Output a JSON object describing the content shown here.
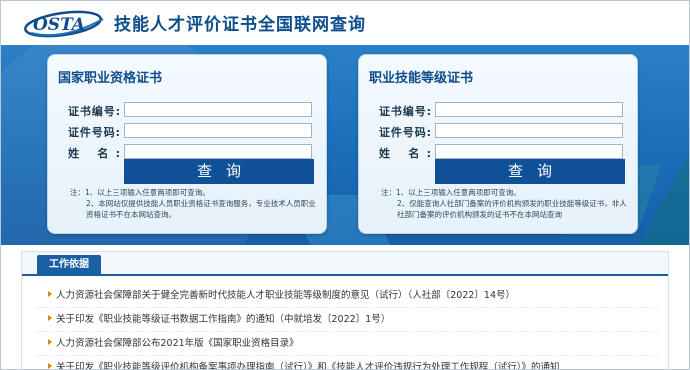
{
  "header": {
    "logo_text": "OSTA",
    "title": "技能人才评价证书全国联网查询"
  },
  "panels": {
    "national": {
      "title": "国家职业资格证书",
      "fields": [
        {
          "label": "证书编号:",
          "value": "",
          "placeholder": ""
        },
        {
          "label": "证件号码:",
          "value": "",
          "placeholder": ""
        },
        {
          "label": "姓 名:",
          "value": "",
          "placeholder": ""
        }
      ],
      "query_label": "查询",
      "notes": [
        "注：1、以上三项输入任意两项即可查询。",
        "2、本网站仅提供技能人员职业资格证书查询服务，专业技术人员职业资格证书不在本网站查询。"
      ]
    },
    "skill": {
      "title": "职业技能等级证书",
      "fields": [
        {
          "label": "证书编号:",
          "value": "",
          "placeholder": ""
        },
        {
          "label": "证件号码:",
          "value": "",
          "placeholder": ""
        },
        {
          "label": "姓 名:",
          "value": "",
          "placeholder": ""
        }
      ],
      "query_label": "查询",
      "notes": [
        "注：1、以上三项输入任意两项即可查询。",
        "2、仅能查询人社部门备案的评价机构颁发的职业技能等级证书，非人社部门备案的评价机构颁发的证书不在本网站查询"
      ]
    }
  },
  "basis": {
    "tab_label": "工作依据",
    "items": [
      "人力资源社会保障部关于健全完善新时代技能人才职业技能等级制度的意见（试行）（人社部〔2022〕14号）",
      "关于印发《职业技能等级证书数据工作指南》的通知（中就培发〔2022〕1号）",
      "人力资源社会保障部公布2021年版《国家职业资格目录》",
      "关于印发《职业技能等级评价机构备案事项办理指南（试行）》和《技能人才评价违规行为处理工作规程（试行）》的通知"
    ]
  },
  "colors": {
    "brand": "#0e4d8c",
    "banner": "#1c6db8",
    "button": "#0f5096",
    "bullet": "#d08a00"
  }
}
